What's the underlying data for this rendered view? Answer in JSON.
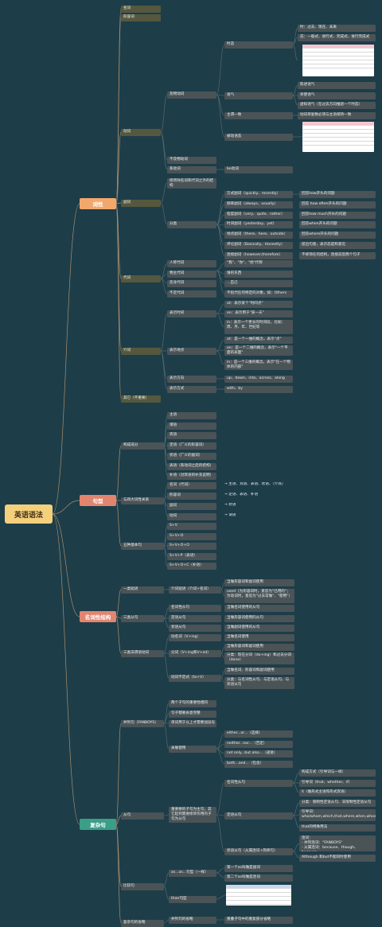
{
  "root": {
    "label": "英语语法"
  },
  "colors": {
    "background": "#1d3d49",
    "root": "#f4cf7c",
    "cixing": "#f2a86c",
    "juxing": "#e2856f",
    "mingci": "#e2856f",
    "fuza": "#3b9e86",
    "node": "#4a5356",
    "edge": "#a98f6e"
  },
  "categories": [
    {
      "label": "词性"
    },
    {
      "label": "句型"
    },
    {
      "label": "名词性结构"
    },
    {
      "label": "复杂句"
    }
  ],
  "cixing": {
    "mingci": "名词",
    "xingrongci": "形容词",
    "dongci": "动词",
    "jiwu": "及物动词",
    "shitai": "时态",
    "shitai_items": [
      "时：过去、现在、未来",
      "态：一般式、进行式、完成式、进行完成式"
    ],
    "yuqi": "语气",
    "yuqi_items": [
      "陈述语气",
      "祈使语气",
      "虚拟语气（在过去方向推退一个时态）"
    ],
    "zhuwei": "主谓一致",
    "zhuwei_text": "动词单复数必须与主语保持一致",
    "beidong": "被动语态",
    "bujiwu": "不及物动词",
    "xidong": "系动词",
    "xidong_text": "be动词",
    "fuci": "副词",
    "fuci_desc": "修饰除名词和代词之外的结构",
    "fenlei": "分类",
    "adverbs": [
      {
        "type": "方式副词（quickly、recently）",
        "note": "回答how开头的问题"
      },
      {
        "type": "频率副词（always、usually）",
        "note": "回答 how often开头的问题"
      },
      {
        "type": "程度副词（very、quite、rather）",
        "note": "回答how much开头的问题"
      },
      {
        "type": "时间副词（yesterday、yet）",
        "note": "回答when开头的问题"
      },
      {
        "type": "地点副词（there、here、outside）",
        "note": "回答where开头的问题"
      },
      {
        "type": "评论副词（Basically、Honestly）",
        "note": "提出句意，表示态度和意见"
      },
      {
        "type": "连接副词（however,therefore）",
        "note": "不修饰任何结构，连接前后两个句子"
      }
    ],
    "daici": "代词",
    "pronouns": [
      {
        "type": "人称代词",
        "note": "\"我\"、\"你\"、\"他\"代称"
      },
      {
        "type": "物主代词",
        "note": "谁的东西"
      },
      {
        "type": "反身代词",
        "note": "...自己"
      },
      {
        "type": "不定代词",
        "note": "不指代任何特定的对象，如：Others"
      }
    ],
    "jieci": "介词",
    "biaoshijian": "表示时间",
    "time_items": [
      "at：表示某个\"时间点\"",
      "on：表示用于\"某一天\"",
      "in：表示一个更长的时间段，比如：周、月、年、世纪等"
    ],
    "biaodidian": "表示地点",
    "place_items": [
      "at：是一个一维的概念，表示\"点\"",
      "on：是一个二维的概念，表示\"一个平面的表面\"",
      "in：是一个三维的概念，表示\"在一个物体的内部\""
    ],
    "biaofangxiang": "表示方向",
    "direction_text": "up、down、into、across、along",
    "biaofangshi": "表示方式",
    "manner_text": "with、by",
    "qita": "其它（不重要）"
  },
  "juxing": {
    "goucheng": "构成成分",
    "components": [
      "主语",
      "谓语",
      "宾语",
      "定语（广义的形容词）",
      "状语（广义的副词）",
      "表语（系动词之后的结构）",
      "补语（对宾语的补充说明）"
    ],
    "guanxi": "与四大词性关系",
    "relations": [
      {
        "pos": "名词（代词）",
        "role": "→ 主语、宾语、表语、状语、（介宾）"
      },
      {
        "pos": "形容词",
        "role": "→ 定语、表语、补语"
      },
      {
        "pos": "副词",
        "role": "→ 状语"
      },
      {
        "pos": "动词",
        "role": "→ 谓语"
      }
    ],
    "wuzhong": "五种基本句",
    "patterns": [
      "S+V",
      "S+V+O",
      "S+V+O+O",
      "S+V+P（表语）",
      "S+V+O+C（补语）"
    ]
  },
  "mingcixing": {
    "yilei": "一类短语",
    "jieci_phrase": "介词短语（介词+名词）",
    "jieci_use1": "当做形容词和副词使用",
    "jieci_use2": "used（为形容词时，意思为\"已用的\"；为动词时，意思为\"过去常做\"、\"使用\"）",
    "sanlei": "三类从句",
    "clauses": [
      {
        "type": "名词性从句",
        "use": "当做名词使用的从句"
      },
      {
        "type": "定语从句",
        "use": "当做形容词使用的从句"
      },
      {
        "type": "状语从句",
        "use": "当做副词使用的从句"
      }
    ],
    "feiwei": "三类非谓语动词",
    "dongmingci": "动名词（V+ing）",
    "dongmingci_use": "当做名词使用",
    "fenci": "分词（V+ing和V+ed）",
    "fenci_use1": "当做形容词和副词使用",
    "fenci_use2": "分类：现在分词（do+ing）和过去分词（done）",
    "budingshi": "动词不定式（to+V）",
    "budingshi_use1": "当做名词、形容词和副词使用",
    "budingshi_use2": "分类：与名词性从句、与定语从句、与状语从句"
  },
  "fuza": {
    "binglie": "并列句（FANBOYS）",
    "binglie_items": [
      "两个子句的重要性相同",
      "句子都要表意完整",
      "单词用于以上才需要加逗号"
    ],
    "guanlian": "关联使用",
    "guanlian_items": [
      "either...or...（选择）",
      "neither...nor...（否定）",
      "not only...but also...（递进）",
      "both...and...（包含）"
    ],
    "congju": "从句",
    "congju_desc": "重要要的子句为主句，其它起到需要修饰作用的子句为从句",
    "mingcixing": "名词性从句",
    "mcx_items": [
      "构成方式（引导词与一样）",
      "引导词（that、whether、if）",
      "it（做形式主语和形式宾语）"
    ],
    "dingyu": "定语从句",
    "dy_items": [
      "分类：限制性定语从句、非限制性定语从句",
      "引导词：who/whom,which,that,where,when,whose",
      "that的特殊用法"
    ],
    "zhuangyu": "状语从句（从属连词+简单句）",
    "zy_items": [
      "连词：\n- 并列连词：\"FANBOYS\"\n- 从属连词：because、though、because...",
      "Although 和but不能同时使用"
    ],
    "bijiao": "比较句",
    "asas": "as...as...句型（一样）",
    "asas_items": [
      "第一个as叫做是副词",
      "第二个as叫做是连词"
    ],
    "than": "than句型",
    "shenglue": "复杂句的省略",
    "shenglue_item": "并列句的省略",
    "shenglue_text": "重叠子句中的重复部分省略"
  }
}
